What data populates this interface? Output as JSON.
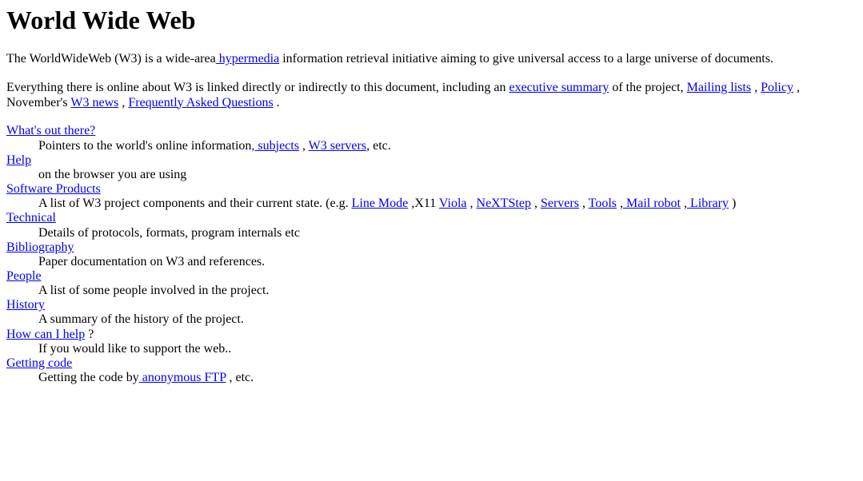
{
  "document": {
    "title": "World Wide Web",
    "link_color": "#0000EE",
    "text_color": "#000000",
    "background_color": "#FFFFFF"
  },
  "intro": {
    "p1_a": "The WorldWideWeb (W3) is a wide-area",
    "p1_link": " hypermedia",
    "p1_b": " information retrieval initiative aiming to give universal access to a large universe of documents.",
    "p2_a": "Everything there is online about W3 is linked directly or indirectly to this document, including an ",
    "p2_link1": "executive summary",
    "p2_b": " of the project, ",
    "p2_link2": "Mailing lists",
    "p2_c": " , ",
    "p2_link3": "Policy",
    "p2_d": " , November's ",
    "p2_link4": "W3 news",
    "p2_e": " , ",
    "p2_link5": "Frequently Asked Questions",
    "p2_f": " ."
  },
  "sections": [
    {
      "term": "What's out there?",
      "desc_a": "Pointers to the world's online information",
      "desc_link1": ", subjects",
      "desc_b": " , ",
      "desc_link2": "W3 servers",
      "desc_c": ", etc."
    },
    {
      "term": "Help",
      "desc_a": "on the browser you are using"
    },
    {
      "term": "Software Products",
      "desc_a": "A list of W3 project components and their current state. (e.g. ",
      "desc_link1": "Line Mode",
      "desc_b": " ,X11 ",
      "desc_link2": "Viola",
      "desc_c": " , ",
      "desc_link3": "NeXTStep",
      "desc_d": " , ",
      "desc_link4": "Servers",
      "desc_e": " , ",
      "desc_link5": "Tools",
      "desc_f": " ,",
      "desc_link6": " Mail robot",
      "desc_g": " ,",
      "desc_link7": " Library",
      "desc_h": " )"
    },
    {
      "term": "Technical",
      "desc_a": "Details of protocols, formats, program internals etc"
    },
    {
      "term": "Bibliography",
      "desc_a": "Paper documentation on W3 and references."
    },
    {
      "term": "People",
      "desc_a": "A list of some people involved in the project."
    },
    {
      "term": "History",
      "desc_a": "A summary of the history of the project."
    },
    {
      "term": "How can I help",
      "term_suffix": " ?",
      "desc_a": "If you would like to support the web.."
    },
    {
      "term": "Getting code",
      "desc_a": "Getting the code by",
      "desc_link1": " anonymous FTP",
      "desc_b": " , etc."
    }
  ]
}
